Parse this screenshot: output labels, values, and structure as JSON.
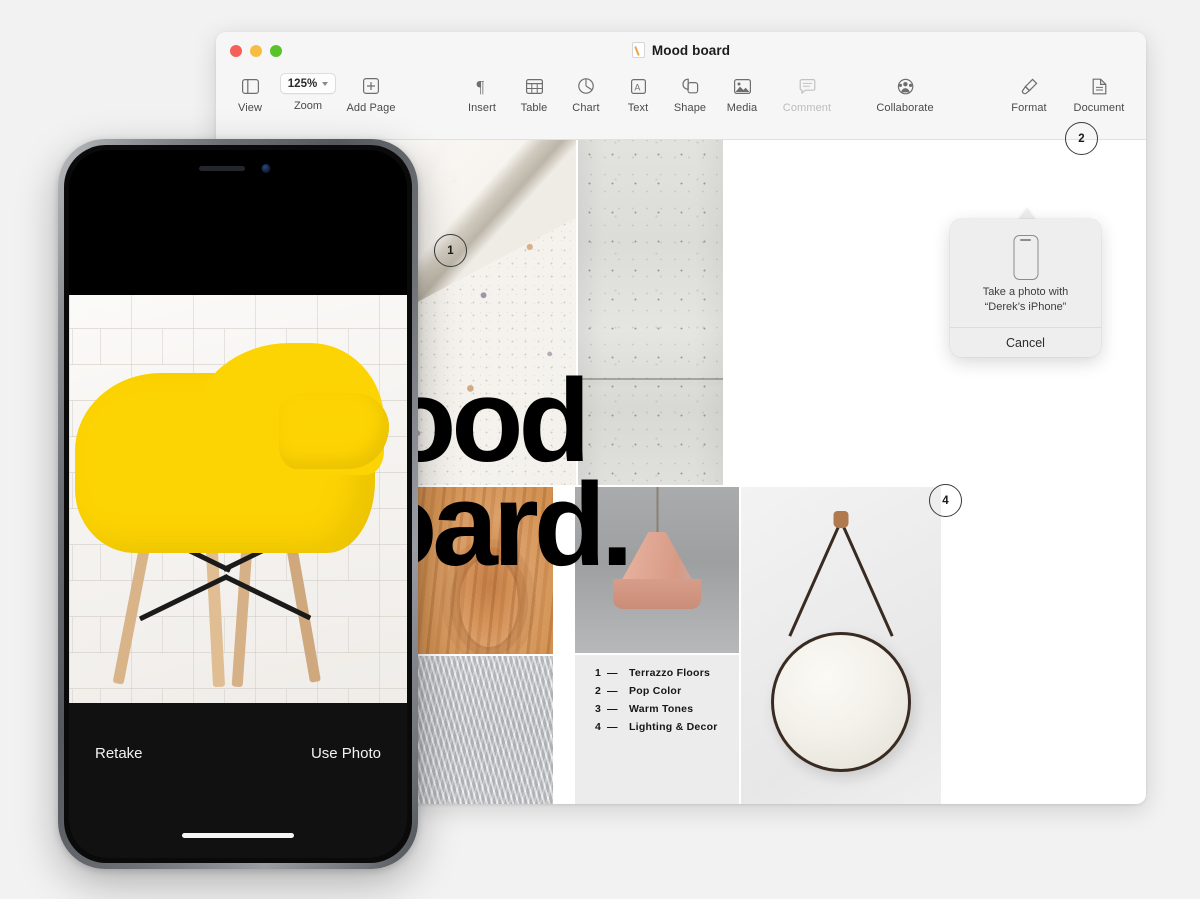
{
  "window": {
    "title": "Mood board",
    "traffic_lights": [
      {
        "name": "close",
        "color": "#f4615b"
      },
      {
        "name": "minimize",
        "color": "#f7bd43"
      },
      {
        "name": "zoom",
        "color": "#5ac32c"
      }
    ]
  },
  "toolbar": {
    "left": [
      {
        "label": "View",
        "icon": "sidebar-icon",
        "disabled": false
      },
      {
        "label": "Zoom",
        "icon": "zoom-stepper",
        "value": "125%",
        "disabled": false
      },
      {
        "label": "Add Page",
        "icon": "add-page-icon",
        "disabled": false
      }
    ],
    "center": [
      {
        "label": "Insert",
        "icon": "pilcrow-icon",
        "disabled": false
      },
      {
        "label": "Table",
        "icon": "table-icon",
        "disabled": false
      },
      {
        "label": "Chart",
        "icon": "chart-pie-icon",
        "disabled": false
      },
      {
        "label": "Text",
        "icon": "text-box-icon",
        "disabled": false
      },
      {
        "label": "Shape",
        "icon": "shape-icon",
        "disabled": false
      },
      {
        "label": "Media",
        "icon": "media-image-icon",
        "disabled": false
      },
      {
        "label": "Comment",
        "icon": "comment-bubble-icon",
        "disabled": true
      }
    ],
    "collaborate": [
      {
        "label": "Collaborate",
        "icon": "collaborate-person-icon",
        "disabled": false
      }
    ],
    "right": [
      {
        "label": "Format",
        "icon": "paintbrush-icon",
        "disabled": false
      },
      {
        "label": "Document",
        "icon": "document-page-icon",
        "disabled": false
      }
    ]
  },
  "document": {
    "headline_line1": "Mood",
    "headline_line2": "Board.",
    "markers": [
      {
        "id": "1",
        "number": "1"
      },
      {
        "id": "2",
        "number": "2"
      },
      {
        "id": "4",
        "number": "4"
      }
    ],
    "legend": [
      {
        "number": "1",
        "dash": "—",
        "label": "Terrazzo Floors"
      },
      {
        "number": "2",
        "dash": "—",
        "label": "Pop Color"
      },
      {
        "number": "3",
        "dash": "—",
        "label": "Warm Tones"
      },
      {
        "number": "4",
        "dash": "—",
        "label": "Lighting & Decor"
      }
    ]
  },
  "popover": {
    "icon": "iphone-icon",
    "message_line1": "Take a photo with",
    "message_line2": "“Derek’s iPhone”",
    "cancel_label": "Cancel"
  },
  "phone": {
    "retake_label": "Retake",
    "use_photo_label": "Use Photo"
  },
  "colors": {
    "accent_yellow": "#fcd303",
    "desktop_background": "#f2f2f2",
    "toolbar_background": "#f6f6f6",
    "popover_background": "#eeeeee"
  }
}
